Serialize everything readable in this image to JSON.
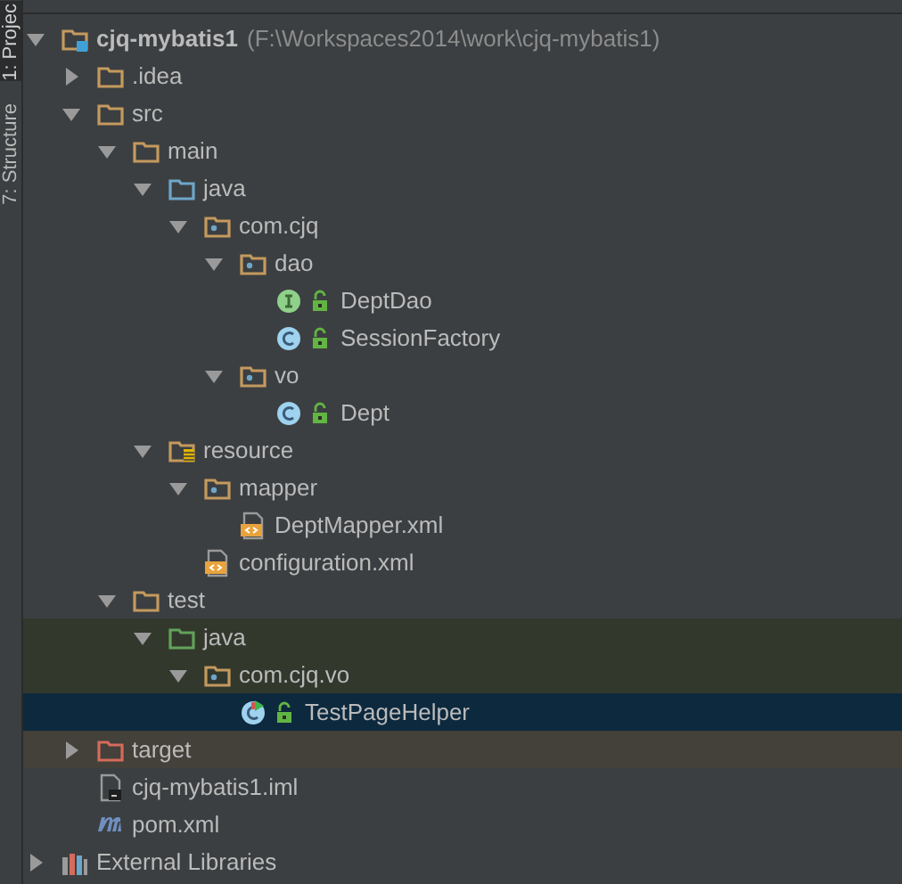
{
  "side_tabs": [
    {
      "label": "1: Projec",
      "selected": true
    },
    {
      "label": "7: Structure",
      "selected": false
    }
  ],
  "tree": [
    {
      "label": "cjq-mybatis1",
      "path": "(F:\\Workspaces2014\\work\\cjq-mybatis1)",
      "kind": "module",
      "expanded": true,
      "selected": false,
      "children": [
        {
          "label": ".idea",
          "kind": "folder",
          "expanded": false,
          "selected": false
        },
        {
          "label": "src",
          "kind": "folder",
          "expanded": true,
          "selected": false,
          "children": [
            {
              "label": "main",
              "kind": "folder",
              "expanded": true,
              "selected": false,
              "children": [
                {
                  "label": "java",
                  "kind": "source-folder",
                  "expanded": true,
                  "selected": false,
                  "children": [
                    {
                      "label": "com.cjq",
                      "kind": "package",
                      "expanded": true,
                      "selected": false,
                      "children": [
                        {
                          "label": "dao",
                          "kind": "package",
                          "expanded": true,
                          "selected": false,
                          "children": [
                            {
                              "label": "DeptDao",
                              "kind": "interface",
                              "selected": false
                            },
                            {
                              "label": "SessionFactory",
                              "kind": "class",
                              "selected": false
                            }
                          ]
                        },
                        {
                          "label": "vo",
                          "kind": "package",
                          "expanded": true,
                          "selected": false,
                          "children": [
                            {
                              "label": "Dept",
                              "kind": "class",
                              "selected": false
                            }
                          ]
                        }
                      ]
                    }
                  ]
                },
                {
                  "label": "resource",
                  "kind": "resource-folder",
                  "expanded": true,
                  "selected": false,
                  "children": [
                    {
                      "label": "mapper",
                      "kind": "package",
                      "expanded": true,
                      "selected": false,
                      "children": [
                        {
                          "label": "DeptMapper.xml",
                          "kind": "xml",
                          "selected": false
                        }
                      ]
                    },
                    {
                      "label": "configuration.xml",
                      "kind": "xml",
                      "selected": false
                    }
                  ]
                }
              ]
            },
            {
              "label": "test",
              "kind": "folder",
              "expanded": true,
              "selected": false,
              "children": [
                {
                  "label": "java",
                  "kind": "test-folder",
                  "expanded": true,
                  "selected": false,
                  "children": [
                    {
                      "label": "com.cjq.vo",
                      "kind": "test-package",
                      "expanded": true,
                      "selected": false,
                      "children": [
                        {
                          "label": "TestPageHelper",
                          "kind": "test-class",
                          "selected": true
                        }
                      ]
                    }
                  ]
                }
              ]
            }
          ]
        },
        {
          "label": "target",
          "kind": "excluded-folder",
          "expanded": false,
          "selected": false
        },
        {
          "label": "cjq-mybatis1.iml",
          "kind": "iml",
          "selected": false
        },
        {
          "label": "pom.xml",
          "kind": "maven",
          "selected": false
        }
      ]
    },
    {
      "label": "External Libraries",
      "kind": "libraries",
      "expanded": false,
      "selected": false
    }
  ]
}
